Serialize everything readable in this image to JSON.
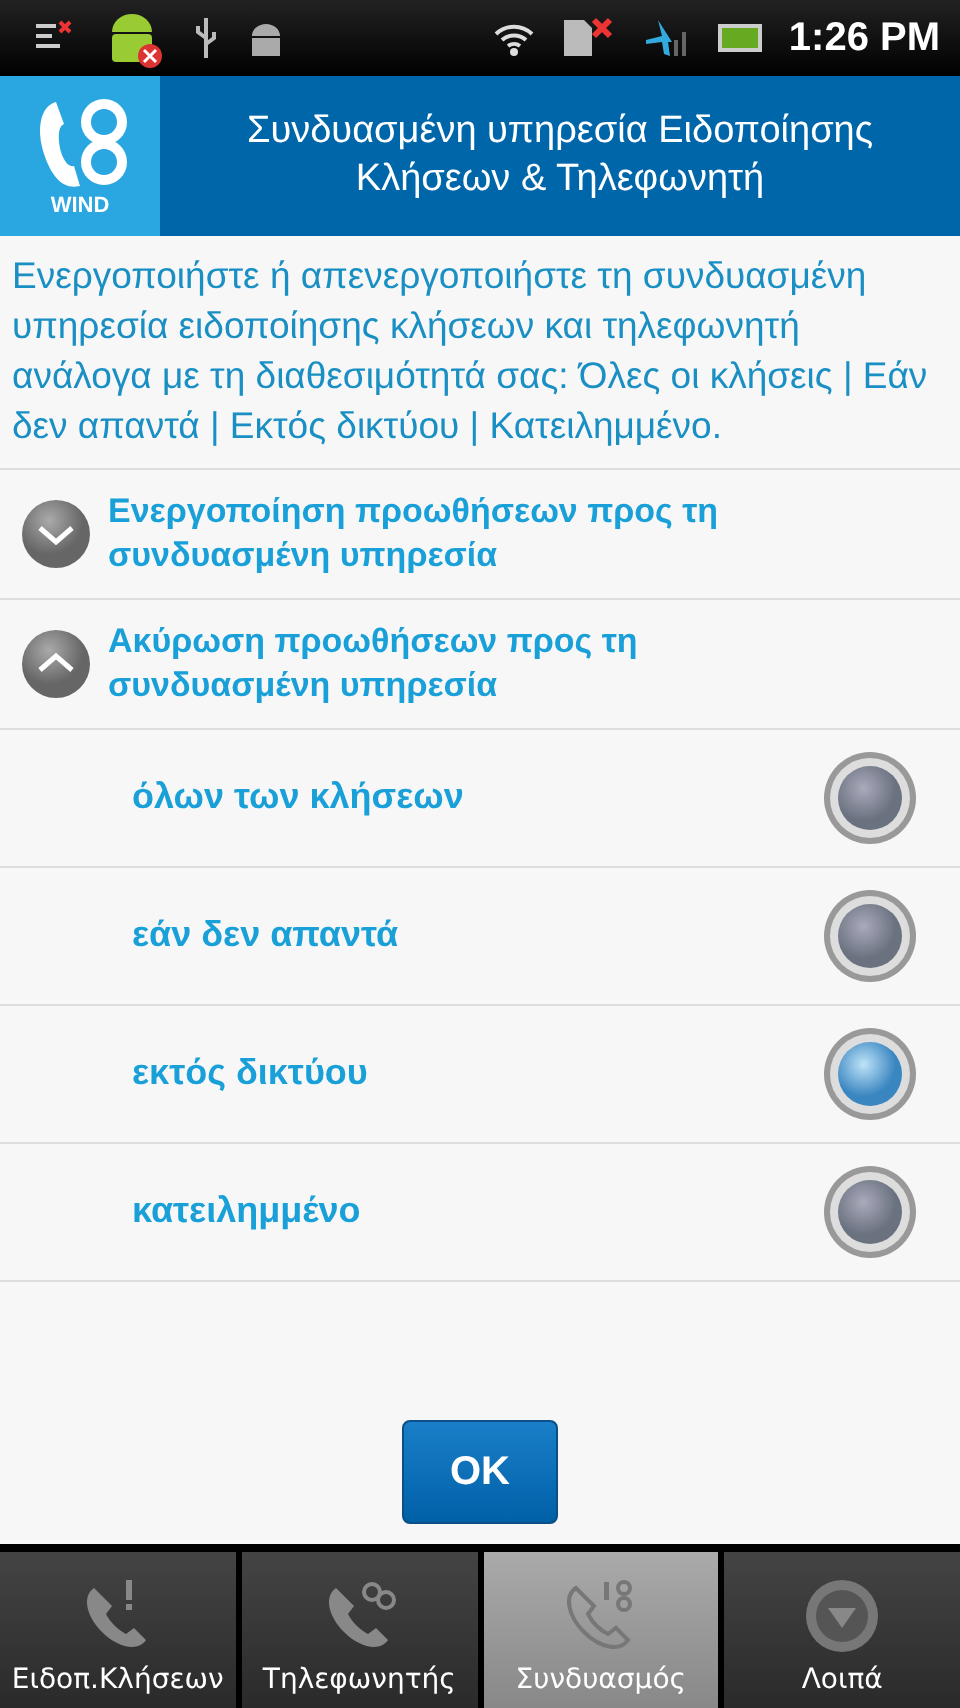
{
  "status_bar": {
    "time": "1:26 PM"
  },
  "header": {
    "logo_text": "WIND",
    "title": "Συνδυασμένη υπηρεσία Ειδοποίησης Κλήσεων & Τηλεφωνητή"
  },
  "description": "Ενεργοποιήστε ή απενεργοποιήστε τη συνδυασμένη υπηρεσία ειδοποίησης κλήσεων και τηλεφωνητή ανάλογα με τη διαθεσιμότητά σας: Όλες οι κλήσεις | Εάν δεν απαντά | Εκτός δικτύου | Κατειλημμένο.",
  "sections": [
    {
      "label": "Ενεργοποίηση προωθήσεων προς τη συνδυασμένη υπηρεσία",
      "expanded": false
    },
    {
      "label": "Ακύρωση προωθήσεων προς τη συνδυασμένη υπηρεσία",
      "expanded": true,
      "options": [
        {
          "label": "όλων των κλήσεων",
          "selected": false
        },
        {
          "label": "εάν δεν απαντά",
          "selected": false
        },
        {
          "label": "εκτός δικτύου",
          "selected": true
        },
        {
          "label": "κατειλημμένο",
          "selected": false
        }
      ]
    }
  ],
  "ok_button": "OK",
  "tabs": [
    {
      "label": "Ειδοπ.Κλήσεων",
      "selected": false,
      "kind": "alert"
    },
    {
      "label": "Τηλεφωνητής",
      "selected": false,
      "kind": "voicemail"
    },
    {
      "label": "Συνδυασμός",
      "selected": true,
      "kind": "combo"
    },
    {
      "label": "Λοιπά",
      "selected": false,
      "kind": "more"
    }
  ]
}
